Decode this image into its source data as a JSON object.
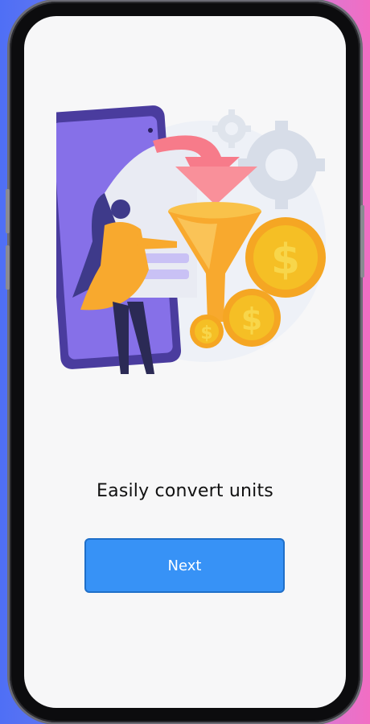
{
  "onboarding": {
    "headline": "Easily convert units",
    "next_label": "Next",
    "illustration_icons": [
      "smartphone-icon",
      "funnel-icon",
      "dollar-coin-icon",
      "gear-icon",
      "woman-figure-icon"
    ]
  },
  "colors": {
    "accent": "#3792f6",
    "background": "#f7f7f8",
    "coin": "#f5bf25",
    "funnel": "#f8a92e",
    "arrow": "#f77b8a",
    "phone_illustration": "#7a66e0"
  }
}
